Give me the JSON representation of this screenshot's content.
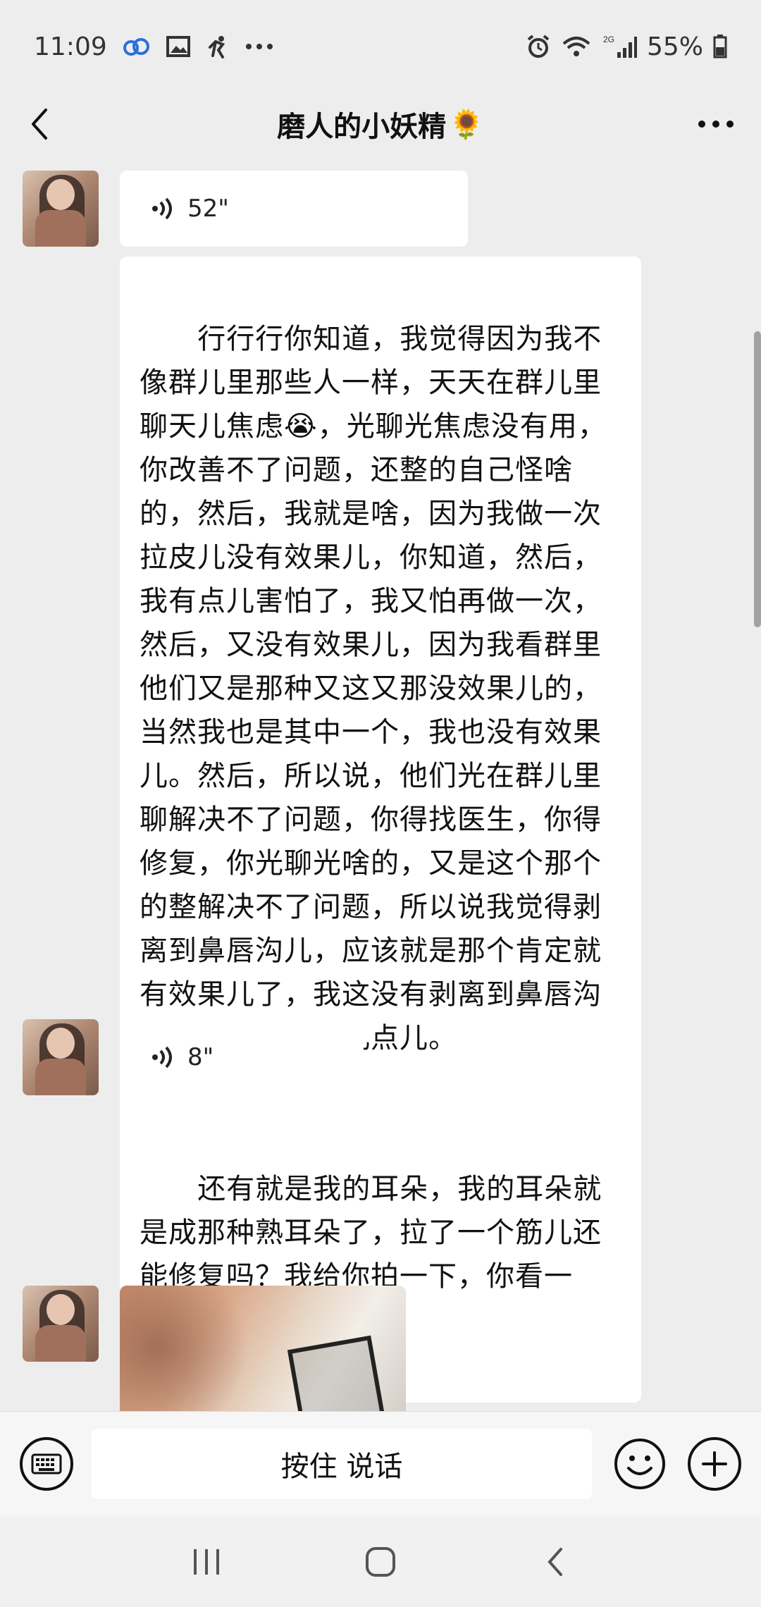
{
  "status_bar": {
    "time": "11:09",
    "battery": "55%",
    "network": "2G",
    "icons": [
      "cloud-app-icon",
      "gallery-icon",
      "fitness-icon",
      "more-dots-icon",
      "alarm-icon",
      "wifi-icon",
      "signal-icon",
      "battery-icon"
    ]
  },
  "header": {
    "title": "磨人的小妖精",
    "title_emoji": "🌻",
    "back_icon": "back-arrow-icon",
    "more_icon": "more-options-icon"
  },
  "messages": [
    {
      "type": "voice",
      "duration": "52\""
    },
    {
      "type": "text",
      "text": "行行行你知道，我觉得因为我不像群儿里那些人一样，天天在群儿里聊天儿焦虑😭，光聊光焦虑没有用，你改善不了问题，还整的自己怪啥的，然后，我就是啥，因为我做一次拉皮儿没有效果儿，你知道，然后，我有点儿害怕了，我又怕再做一次，然后，又没有效果儿，因为我看群里他们又是那种又这又那没效果儿的，当然我也是其中一个，我也没有效果儿。然后，所以说，他们光在群儿里聊解决不了问题，你得找医生，你得修复，你光聊光啥的，又是这个那个的整解决不了问题，所以说我觉得剥离到鼻唇沟儿，应该就是那个肯定就有效果儿了，我这没有剥离到鼻唇沟儿，就耳前一点儿点儿。"
    },
    {
      "type": "voice",
      "duration": "8\""
    },
    {
      "type": "text",
      "text": "还有就是我的耳朵，我的耳朵就是成那种熟耳朵了，拉了一个筋儿还能修复吗？我给你拍一下，你看一下。"
    },
    {
      "type": "image"
    }
  ],
  "input_bar": {
    "hold_to_talk": "按住 说话"
  },
  "colors": {
    "background": "#ededed",
    "bubble": "#ffffff",
    "text": "#111111"
  }
}
